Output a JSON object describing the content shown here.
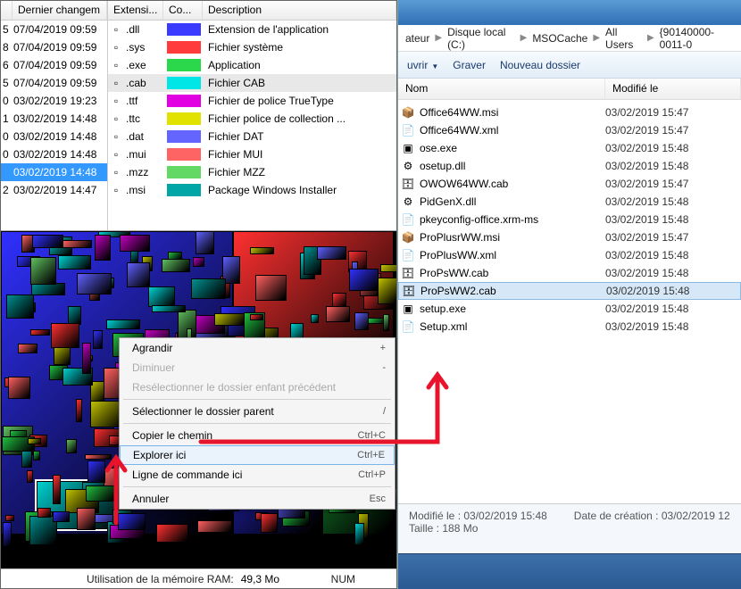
{
  "left": {
    "headers": {
      "date": "Dernier changem",
      "ext": "Extensi...",
      "color": "Co...",
      "desc": "Description"
    },
    "dates": [
      {
        "n": "5",
        "d": "07/04/2019 09:59"
      },
      {
        "n": "8",
        "d": "07/04/2019 09:59"
      },
      {
        "n": "6",
        "d": "07/04/2019 09:59"
      },
      {
        "n": "5",
        "d": "07/04/2019 09:59"
      },
      {
        "n": "0",
        "d": "03/02/2019 19:23"
      },
      {
        "n": "1",
        "d": "03/02/2019 14:48"
      },
      {
        "n": "0",
        "d": "03/02/2019 14:48"
      },
      {
        "n": "0",
        "d": "03/02/2019 14:48"
      },
      {
        "n": "",
        "d": "03/02/2019 14:48",
        "sel": true
      },
      {
        "n": "2",
        "d": "03/02/2019 14:47"
      }
    ],
    "extensions": [
      {
        "ext": ".dll",
        "color": "#3b3bff",
        "desc": "Extension de l'application"
      },
      {
        "ext": ".sys",
        "color": "#ff3b3b",
        "desc": "Fichier système"
      },
      {
        "ext": ".exe",
        "color": "#2bd84b",
        "desc": "Application"
      },
      {
        "ext": ".cab",
        "color": "#00e5e5",
        "desc": "Fichier CAB",
        "sel": true
      },
      {
        "ext": ".ttf",
        "color": "#e200e2",
        "desc": "Fichier de police TrueType"
      },
      {
        "ext": ".ttc",
        "color": "#e2e200",
        "desc": "Fichier police de collection ..."
      },
      {
        "ext": ".dat",
        "color": "#6464ff",
        "desc": "Fichier DAT"
      },
      {
        "ext": ".mui",
        "color": "#ff6464",
        "desc": "Fichier MUI"
      },
      {
        "ext": ".mzz",
        "color": "#64d864",
        "desc": "Fichier MZZ"
      },
      {
        "ext": ".msi",
        "color": "#00a5a5",
        "desc": "Package Windows Installer"
      }
    ]
  },
  "contextmenu": [
    {
      "label": "Agrandir",
      "short": "+",
      "type": "item"
    },
    {
      "label": "Diminuer",
      "short": "-",
      "type": "item",
      "disabled": true
    },
    {
      "label": "Resélectionner le dossier enfant précédent",
      "type": "item",
      "disabled": true
    },
    {
      "type": "sep"
    },
    {
      "label": "Sélectionner le dossier parent",
      "short": "/",
      "type": "item"
    },
    {
      "type": "sep"
    },
    {
      "label": "Copier le chemin",
      "short": "Ctrl+C",
      "type": "item"
    },
    {
      "label": "Explorer ici",
      "short": "Ctrl+E",
      "type": "item",
      "sel": true
    },
    {
      "label": "Ligne de commande ici",
      "short": "Ctrl+P",
      "type": "item"
    },
    {
      "type": "sep"
    },
    {
      "label": "Annuler",
      "short": "Esc",
      "type": "item"
    }
  ],
  "statusbar": {
    "ram_label": "Utilisation de la mémoire RAM:",
    "ram_value": "49,3 Mo",
    "num": "NUM"
  },
  "explorer": {
    "breadcrumbs": [
      "ateur",
      "Disque local (C:)",
      "MSOCache",
      "All Users",
      "{90140000-0011-0"
    ],
    "toolbar": {
      "open": "uvrir",
      "burn": "Graver",
      "newfolder": "Nouveau dossier"
    },
    "headers": {
      "name": "Nom",
      "modified": "Modifié le"
    },
    "files": [
      {
        "icon": "msi",
        "name": "Office64WW.msi",
        "date": "03/02/2019 15:47"
      },
      {
        "icon": "xml",
        "name": "Office64WW.xml",
        "date": "03/02/2019 15:47"
      },
      {
        "icon": "exe",
        "name": "ose.exe",
        "date": "03/02/2019 15:48"
      },
      {
        "icon": "dll",
        "name": "osetup.dll",
        "date": "03/02/2019 15:48"
      },
      {
        "icon": "cab",
        "name": "OWOW64WW.cab",
        "date": "03/02/2019 15:47"
      },
      {
        "icon": "dll",
        "name": "PidGenX.dll",
        "date": "03/02/2019 15:48"
      },
      {
        "icon": "txt",
        "name": "pkeyconfig-office.xrm-ms",
        "date": "03/02/2019 15:48"
      },
      {
        "icon": "msi",
        "name": "ProPlusrWW.msi",
        "date": "03/02/2019 15:47"
      },
      {
        "icon": "xml",
        "name": "ProPlusWW.xml",
        "date": "03/02/2019 15:48"
      },
      {
        "icon": "cab",
        "name": "ProPsWW.cab",
        "date": "03/02/2019 15:48"
      },
      {
        "icon": "cab",
        "name": "ProPsWW2.cab",
        "date": "03/02/2019 15:48",
        "sel": true
      },
      {
        "icon": "exe",
        "name": "setup.exe",
        "date": "03/02/2019 15:48"
      },
      {
        "icon": "xml",
        "name": "Setup.xml",
        "date": "03/02/2019 15:48"
      }
    ],
    "details": {
      "modified_label": "Modifié le :",
      "modified": "03/02/2019 15:48",
      "created_label": "Date de création :",
      "created": "03/02/2019 12",
      "size_label": "Taille :",
      "size": "188 Mo"
    }
  },
  "icons": {
    "file": "📄",
    "msi": "📦",
    "xml": "📄",
    "exe": "▣",
    "dll": "⚙",
    "cab": "🗄",
    "txt": "📄"
  }
}
